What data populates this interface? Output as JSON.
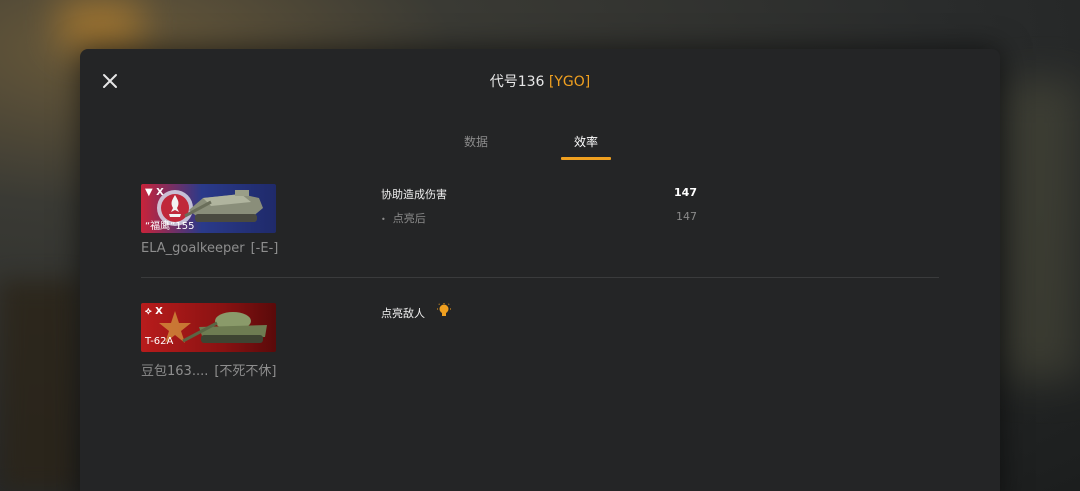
{
  "header": {
    "title": "代号136",
    "clan_tag": "[YGO]"
  },
  "tabs": [
    {
      "label": "数据",
      "active": false
    },
    {
      "label": "效率",
      "active": true
    }
  ],
  "entries": [
    {
      "tier": "▼ X",
      "tank_name": "“福鹰”155",
      "player": "ELA_goalkeeper",
      "clan": "[-E-]",
      "card_color": "#2a3a8a",
      "stats": [
        {
          "label": "协助造成伤害",
          "value": "147"
        },
        {
          "label": "点亮后",
          "value": "147",
          "sub": true
        }
      ]
    },
    {
      "tier": "X",
      "tank_name": "T-62A",
      "player": "豆包163....",
      "clan": "[不死不休]",
      "card_color": "#b81c1c",
      "stats": [
        {
          "label": "点亮敌人",
          "icon": "lightbulb-icon"
        }
      ]
    }
  ],
  "colors": {
    "accent": "#f0a020",
    "panel": "#242526"
  }
}
